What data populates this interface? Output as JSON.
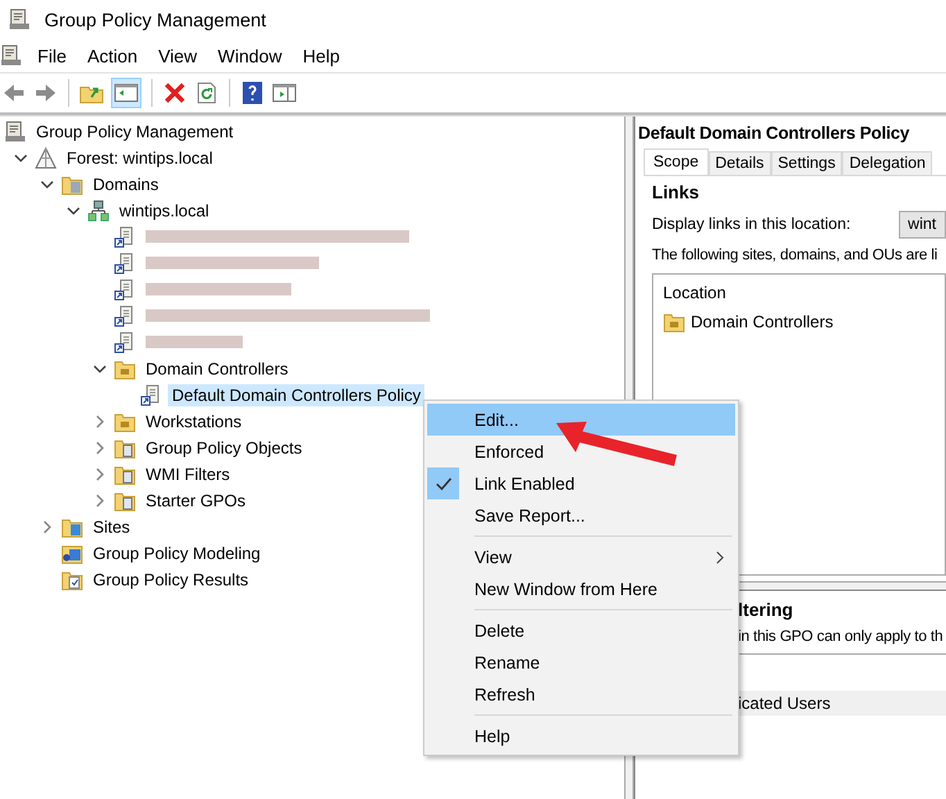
{
  "window": {
    "title": "Group Policy Management"
  },
  "menu_bar": [
    "File",
    "Action",
    "View",
    "Window",
    "Help"
  ],
  "tree": {
    "label": "Group Policy Management",
    "kind": "root",
    "selected": false,
    "children": [
      {
        "label": "Forest: wintips.local",
        "kind": "forest",
        "expanded": true,
        "selected": false,
        "children": [
          {
            "label": "Domains",
            "kind": "domains",
            "expanded": true,
            "selected": false,
            "children": [
              {
                "label": "wintips.local",
                "kind": "domain",
                "expanded": true,
                "selected": false,
                "children": [
                  {
                    "kind": "gpo-link",
                    "redacted": true,
                    "selected": false
                  },
                  {
                    "kind": "gpo-link",
                    "redacted": true,
                    "selected": false
                  },
                  {
                    "kind": "gpo-link",
                    "redacted": true,
                    "selected": false
                  },
                  {
                    "kind": "gpo-link",
                    "redacted": true,
                    "selected": false
                  },
                  {
                    "kind": "gpo-link",
                    "redacted": true,
                    "selected": false
                  },
                  {
                    "label": "Domain Controllers",
                    "kind": "ou",
                    "expanded": true,
                    "selected": false,
                    "children": [
                      {
                        "label": "Default Domain Controllers Policy",
                        "kind": "gpo-link",
                        "redacted": false,
                        "selected": true
                      }
                    ]
                  },
                  {
                    "label": "Workstations",
                    "kind": "ou",
                    "expanded": false,
                    "selected": false
                  },
                  {
                    "label": "Group Policy Objects",
                    "kind": "folder",
                    "expanded": false,
                    "selected": false
                  },
                  {
                    "label": "WMI Filters",
                    "kind": "folder",
                    "expanded": false,
                    "selected": false
                  },
                  {
                    "label": "Starter GPOs",
                    "kind": "folder",
                    "expanded": false,
                    "selected": false
                  }
                ]
              }
            ]
          },
          {
            "label": "Sites",
            "kind": "sites",
            "expanded": false,
            "selected": false
          },
          {
            "label": "Group Policy Modeling",
            "kind": "modeling",
            "selected": false
          },
          {
            "label": "Group Policy Results",
            "kind": "results",
            "selected": false
          }
        ]
      }
    ]
  },
  "details": {
    "title": "Default Domain Controllers Policy",
    "tabs": [
      {
        "label": "Scope",
        "selected": true
      },
      {
        "label": "Details",
        "selected": false
      },
      {
        "label": "Settings",
        "selected": false
      },
      {
        "label": "Delegation",
        "selected": false
      }
    ],
    "links_heading": "Links",
    "display_label": "Display links in this location:",
    "display_value": "wint",
    "following_text": "The following sites, domains, and OUs are li",
    "location_column": "Location",
    "location_rows": [
      "Domain Controllers"
    ],
    "filtering_heading": "ltering",
    "filtering_text": "in this GPO can only apply to th",
    "filter_rows": [
      "icated Users"
    ]
  },
  "context_menu": [
    {
      "kind": "item",
      "label": "Edit...",
      "selected": true,
      "checked": false,
      "submenu": false
    },
    {
      "kind": "item",
      "label": "Enforced",
      "selected": false,
      "checked": false,
      "submenu": false
    },
    {
      "kind": "item",
      "label": "Link Enabled",
      "selected": false,
      "checked": true,
      "submenu": false
    },
    {
      "kind": "item",
      "label": "Save Report...",
      "selected": false,
      "checked": false,
      "submenu": false
    },
    {
      "kind": "separator"
    },
    {
      "kind": "item",
      "label": "View",
      "selected": false,
      "checked": false,
      "submenu": true
    },
    {
      "kind": "item",
      "label": "New Window from Here",
      "selected": false,
      "checked": false,
      "submenu": false
    },
    {
      "kind": "separator"
    },
    {
      "kind": "item",
      "label": "Delete",
      "selected": false,
      "checked": false,
      "submenu": false
    },
    {
      "kind": "item",
      "label": "Rename",
      "selected": false,
      "checked": false,
      "submenu": false
    },
    {
      "kind": "item",
      "label": "Refresh",
      "selected": false,
      "checked": false,
      "submenu": false
    },
    {
      "kind": "separator"
    },
    {
      "kind": "item",
      "label": "Help",
      "selected": false,
      "checked": false,
      "submenu": false
    }
  ]
}
